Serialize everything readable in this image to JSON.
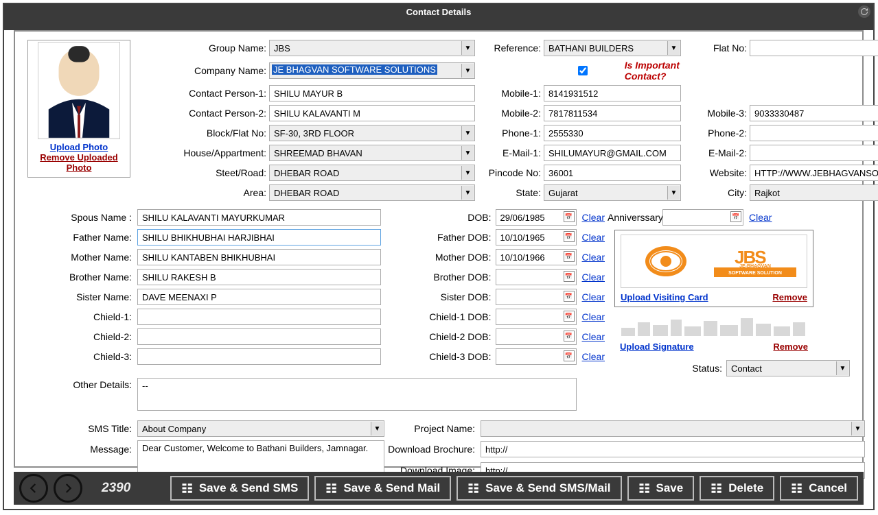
{
  "window": {
    "title": "Contact Details"
  },
  "photo": {
    "upload_label": "Upload Photo",
    "remove_label": "Remove Uploaded Photo"
  },
  "labels": {
    "group_name": "Group Name:",
    "reference": "Reference:",
    "flat_no": "Flat No:",
    "company_name": "Company Name:",
    "important": "Is Important Contact?",
    "contact1": "Contact Person-1:",
    "mobile1": "Mobile-1:",
    "contact2": "Contact Person-2:",
    "mobile2": "Mobile-2:",
    "mobile3": "Mobile-3:",
    "block": "Block/Flat No:",
    "phone1": "Phone-1:",
    "phone2": "Phone-2:",
    "house": "House/Appartment:",
    "email1": "E-Mail-1:",
    "email2": "E-Mail-2:",
    "street": "Steet/Road:",
    "pincode": "Pincode No:",
    "website": "Website:",
    "area": "Area:",
    "state": "State:",
    "city": "City:",
    "spouse": "Spous Name :",
    "dob": "DOB:",
    "anniversary": "Anniverssary:",
    "father": "Father Name:",
    "father_dob": "Father DOB:",
    "mother": "Mother Name:",
    "mother_dob": "Mother DOB:",
    "brother": "Brother Name:",
    "brother_dob": "Brother DOB:",
    "sister": "Sister Name:",
    "sister_dob": "Sister DOB:",
    "child1": "Chield-1:",
    "child1_dob": "Chield-1 DOB:",
    "child2": "Chield-2:",
    "child2_dob": "Chield-2 DOB:",
    "child3": "Chield-3:",
    "child3_dob": "Chield-3 DOB:",
    "other": "Other Details:",
    "status": "Status:",
    "sms_title": "SMS Title:",
    "project": "Project Name:",
    "message": "Message:",
    "brochure": "Download Brochure:",
    "image": "Download Image:",
    "clear": "Clear"
  },
  "values": {
    "group_name": "JBS",
    "reference": "BATHANI BUILDERS",
    "flat_no": "",
    "company_name": "JE BHAGVAN SOFTWARE SOLUTIONS",
    "important": true,
    "contact1": "SHILU MAYUR B",
    "mobile1": "8141931512",
    "contact2": "SHILU KALAVANTI M",
    "mobile2": "7817811534",
    "mobile3": "9033330487",
    "block": "SF-30, 3RD FLOOR",
    "phone1": "2555330",
    "phone2": "",
    "house": "SHREEMAD BHAVAN",
    "email1": "SHILUMAYUR@GMAIL.COM",
    "email2": "",
    "street": "DHEBAR ROAD",
    "pincode": "36001",
    "website": "HTTP://WWW.JEBHAGVANSOFTWARE",
    "area": "DHEBAR ROAD",
    "state": "Gujarat",
    "city": "Rajkot",
    "spouse": "SHILU KALAVANTI MAYURKUMAR",
    "dob": "29/06/1985",
    "anniversary": "",
    "father": "SHILU BHIKHUBHAI HARJIBHAI",
    "father_dob": "10/10/1965",
    "mother": "SHILU KANTABEN BHIKHUBHAI",
    "mother_dob": "10/10/1966",
    "brother": "SHILU RAKESH B",
    "brother_dob": "",
    "sister": "DAVE MEENAXI P",
    "sister_dob": "",
    "child1": "",
    "child1_dob": "",
    "child2": "",
    "child2_dob": "",
    "child3": "",
    "child3_dob": "",
    "other": "--",
    "status": "Contact",
    "sms_title": "About Company",
    "project": "",
    "message": "Dear Customer, Welcome to Bathani Builders, Jamnagar.",
    "brochure": "http://",
    "image": "http://"
  },
  "cards": {
    "visit_upload": "Upload Visiting Card",
    "visit_remove": "Remove",
    "sig_upload": "Upload Signature",
    "sig_remove": "Remove"
  },
  "footer": {
    "record": "2390",
    "save_sms": "Save & Send SMS",
    "save_mail": "Save & Send Mail",
    "save_both": "Save & Send SMS/Mail",
    "save": "Save",
    "delete": "Delete",
    "cancel": "Cancel"
  }
}
